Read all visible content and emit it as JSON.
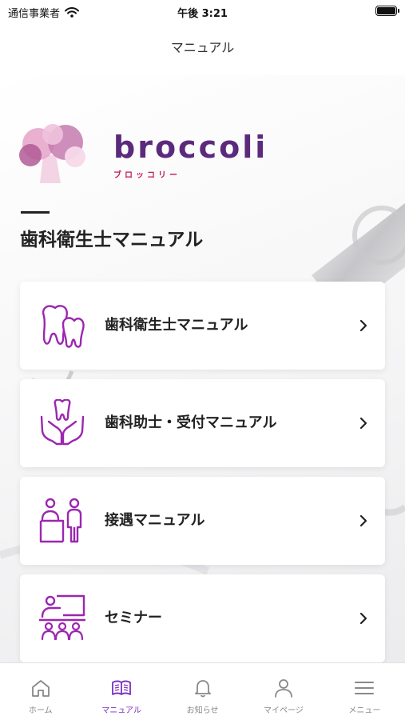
{
  "status_bar": {
    "carrier": "通信事業者",
    "time": "午後 3:21",
    "wifi_icon": "wifi-icon",
    "battery_icon": "battery-icon"
  },
  "header": {
    "title": "マニュアル"
  },
  "logo": {
    "text": "broccoli",
    "subtext": "ブロッコリー"
  },
  "section": {
    "title": "歯科衛生士マニュアル"
  },
  "menu_items": [
    {
      "label": "歯科衛生士マニュアル",
      "icon": "teeth-icon"
    },
    {
      "label": "歯科助士・受付マニュアル",
      "icon": "hands-tooth-icon"
    },
    {
      "label": "接遇マニュアル",
      "icon": "reception-icon"
    },
    {
      "label": "セミナー",
      "icon": "seminar-icon"
    }
  ],
  "tabs": [
    {
      "label": "ホーム",
      "icon": "home-icon",
      "active": false
    },
    {
      "label": "マニュアル",
      "icon": "book-icon",
      "active": true
    },
    {
      "label": "お知らせ",
      "icon": "bell-icon",
      "active": false
    },
    {
      "label": "マイページ",
      "icon": "person-icon",
      "active": false
    },
    {
      "label": "メニュー",
      "icon": "menu-icon",
      "active": false
    }
  ],
  "colors": {
    "accent": "#7b2fbe",
    "icon_purple": "#9b27b0",
    "logo_text": "#5b2a7c",
    "logo_pink": "#d96aa7"
  }
}
